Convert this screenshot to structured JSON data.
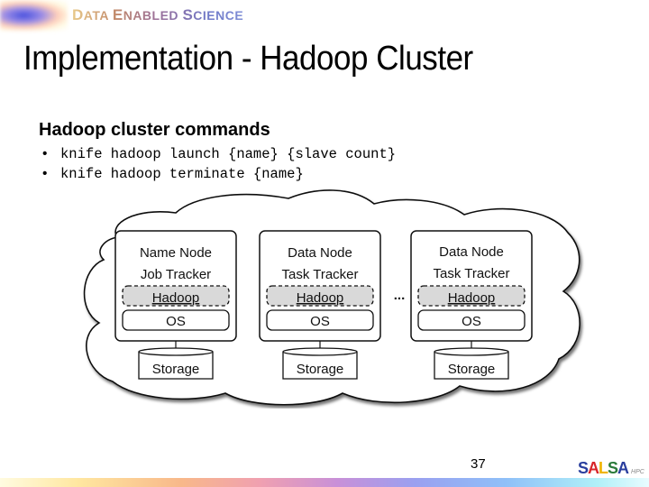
{
  "header": {
    "logo_text_parts": [
      {
        "cap": "D",
        "rest": "ATA "
      },
      {
        "cap": "E",
        "rest": "NABLED "
      },
      {
        "cap": "S",
        "rest": "CIENCE"
      }
    ],
    "logo_icon": "gradient-blob-logo"
  },
  "slide": {
    "title": "Implementation - Hadoop Cluster",
    "subheading": "Hadoop cluster commands",
    "bullets": [
      {
        "marker": "•",
        "text": "knife hadoop launch {name} {slave count}"
      },
      {
        "marker": "•",
        "text": "knife hadoop terminate {name}"
      }
    ]
  },
  "diagram": {
    "container": "cloud",
    "ellipsis": "...",
    "nodes": [
      {
        "line1": "Name Node",
        "line2": "Job Tracker",
        "framework": "Hadoop",
        "os": "OS",
        "storage": "Storage"
      },
      {
        "line1": "Data Node",
        "line2": "Task Tracker",
        "framework": "Hadoop",
        "os": "OS",
        "storage": "Storage"
      },
      {
        "line1": "Data Node",
        "line2": "Task Tracker",
        "framework": "Hadoop",
        "os": "OS",
        "storage": "Storage"
      }
    ],
    "colors": {
      "hadoop_fill": "#d9d9d9",
      "stroke": "#222222"
    }
  },
  "footer": {
    "page_number": "37",
    "brand": {
      "letters": [
        "S",
        "A",
        "L",
        "S",
        "A"
      ],
      "suffix": "HPC"
    }
  }
}
